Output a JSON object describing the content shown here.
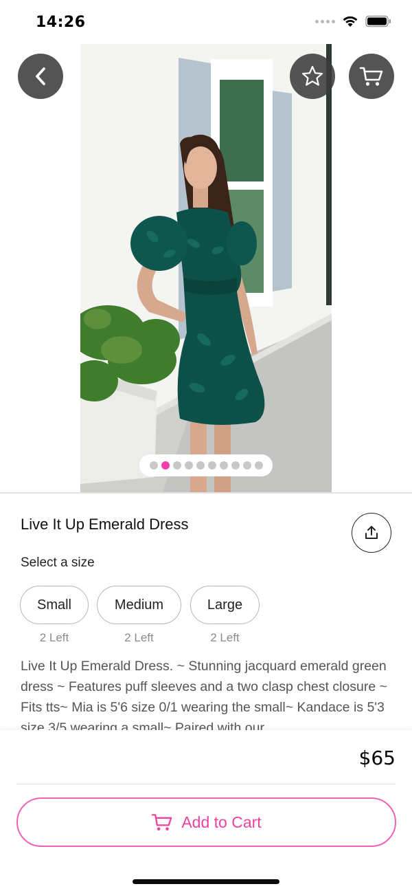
{
  "status_bar": {
    "time": "14:26",
    "icons": [
      "signal-icon",
      "wifi-icon",
      "battery-icon"
    ]
  },
  "header": {
    "icons": [
      "back-chevron-icon",
      "star-icon",
      "cart-icon"
    ]
  },
  "gallery": {
    "image_count": 10,
    "active_index": 1,
    "subject": "woman in emerald green dress on porch"
  },
  "product": {
    "title": "Live It Up Emerald Dress",
    "size_heading": "Select a size",
    "sizes": [
      {
        "label": "Small",
        "stock": "2 Left"
      },
      {
        "label": "Medium",
        "stock": "2 Left"
      },
      {
        "label": "Large",
        "stock": "2 Left"
      }
    ],
    "description": "Live It Up Emerald Dress. ~ Stunning jacquard emerald green dress ~ Features puff sleeves and a two clasp chest closure ~ Fits tts~ Mia is 5'6 size 0/1 wearing the small~ Kandace is 5'3 size 3/5 wearing a small~ Paired with our"
  },
  "purchase": {
    "price": "$65",
    "add_to_cart_label": "Add to Cart"
  },
  "colors": {
    "accent": "#f043a9",
    "button_overlay": "#3c3c3c",
    "dress": "#0d5048"
  }
}
